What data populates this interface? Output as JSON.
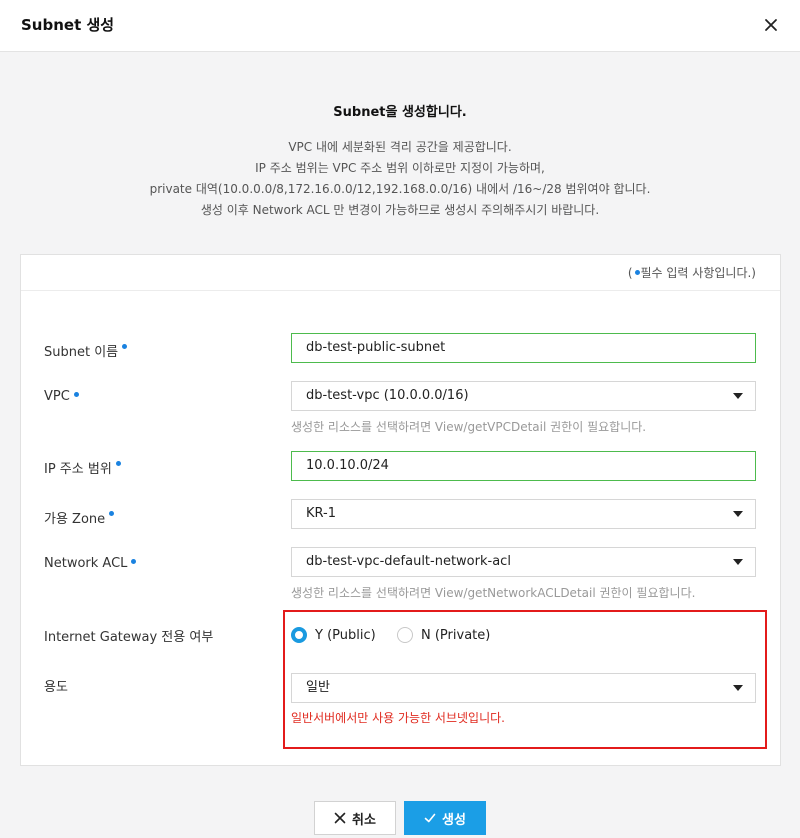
{
  "dialog": {
    "title": "Subnet 생성"
  },
  "intro": {
    "heading": "Subnet을 생성합니다.",
    "lines": [
      "VPC 내에 세분화된 격리 공간을 제공합니다.",
      "IP 주소 범위는 VPC 주소 범위 이하로만 지정이 가능하며,",
      "private 대역(10.0.0.0/8,172.16.0.0/12,192.168.0.0/16) 내에서 /16~/28 범위여야 합니다.",
      "생성 이후 Network ACL 만 변경이 가능하므로 생성시 주의해주시기 바랍니다."
    ]
  },
  "required_note": {
    "open": "(",
    "text": "필수 입력 사항입니다.)"
  },
  "form": {
    "subnet_name": {
      "label": "Subnet 이름",
      "value": "db-test-public-subnet"
    },
    "vpc": {
      "label": "VPC",
      "value": "db-test-vpc (10.0.0.0/16)",
      "hint": "생성한 리소스를 선택하려면 View/getVPCDetail 권한이 필요합니다."
    },
    "ip_range": {
      "label": "IP 주소 범위",
      "value": "10.0.10.0/24"
    },
    "zone": {
      "label": "가용 Zone",
      "value": "KR-1"
    },
    "network_acl": {
      "label": "Network ACL",
      "value": "db-test-vpc-default-network-acl",
      "hint": "생성한 리소스를 선택하려면 View/getNetworkACLDetail 권한이 필요합니다."
    },
    "internet_gateway": {
      "label": "Internet Gateway 전용 여부",
      "option_yes": "Y (Public)",
      "option_no": "N (Private)",
      "selected": "Y (Public)"
    },
    "usage": {
      "label": "용도",
      "value": "일반",
      "warning": "일반서버에서만 사용 가능한 서브넷입니다."
    }
  },
  "buttons": {
    "cancel": "취소",
    "create": "생성"
  },
  "colors": {
    "accent": "#1b9ee6",
    "valid_border": "#4dbb4d",
    "warning": "#e02b20",
    "highlight_box": "#e31b1b"
  }
}
